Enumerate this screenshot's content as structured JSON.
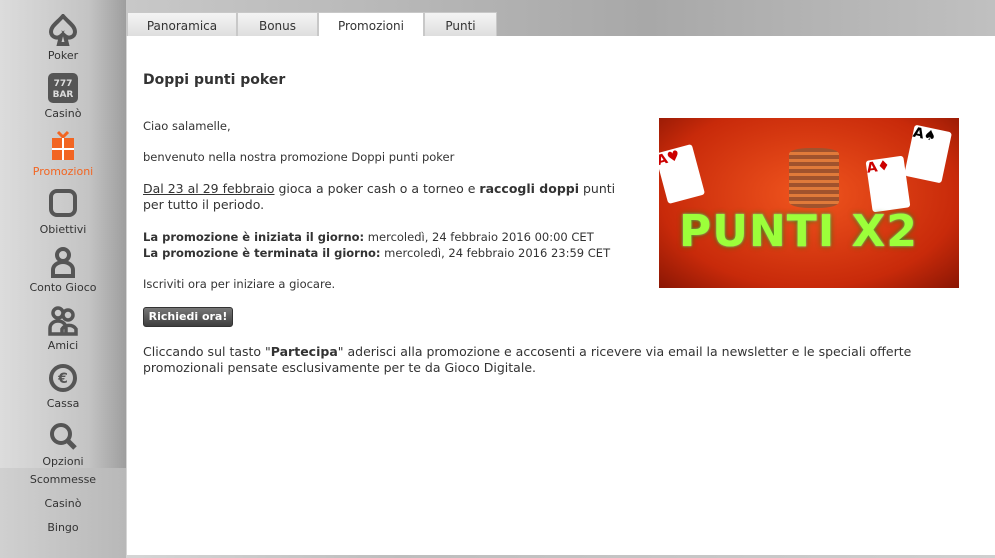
{
  "sidebar": {
    "items": [
      {
        "label": "Poker",
        "icon": "spade-icon"
      },
      {
        "label": "Casinò",
        "icon": "slot-machine-icon"
      },
      {
        "label": "Promozioni",
        "icon": "gift-icon",
        "active": true
      },
      {
        "label": "Obiettivi",
        "icon": "square-icon"
      },
      {
        "label": "Conto Gioco",
        "icon": "user-icon"
      },
      {
        "label": "Amici",
        "icon": "friends-icon"
      },
      {
        "label": "Cassa",
        "icon": "euro-icon"
      },
      {
        "label": "Opzioni",
        "icon": "wrench-icon"
      }
    ],
    "links": [
      "Scommesse",
      "Casinò",
      "Bingo"
    ],
    "active_color": "#f26522"
  },
  "tabs": [
    "Panoramica",
    "Bonus",
    "Promozioni",
    "Punti"
  ],
  "active_tab": "Promozioni",
  "content": {
    "title": "Doppi punti poker",
    "greeting": "Ciao salamelle,",
    "welcome": "benvenuto nella nostra promozione Doppi punti poker",
    "period_link": "Dal 23 al 29 febbraio",
    "period_text1": " gioca a poker cash o a torneo e ",
    "period_bold": "raccogli doppi",
    "period_text2": " punti per tutto il periodo.",
    "start_label": "La promozione è iniziata il giorno:",
    "start_value": " mercoledì, 24 febbraio 2016 00:00 CET",
    "end_label": "La promozione è terminata il giorno:",
    "end_value": " mercoledì, 24 febbraio 2016 23:59 CET",
    "cta_text": "Iscriviti ora per iniziare a giocare.",
    "button": "Richiedi ora!",
    "footer1": "Cliccando sul tasto \"",
    "footer_bold": "Partecipa",
    "footer2": "\" aderisci alla promozione e accosenti a ricevere via email la newsletter e le speciali offerte promozionali pensate esclusivamente per te da Gioco Digitale.",
    "banner_text": "PUNTI X2"
  }
}
